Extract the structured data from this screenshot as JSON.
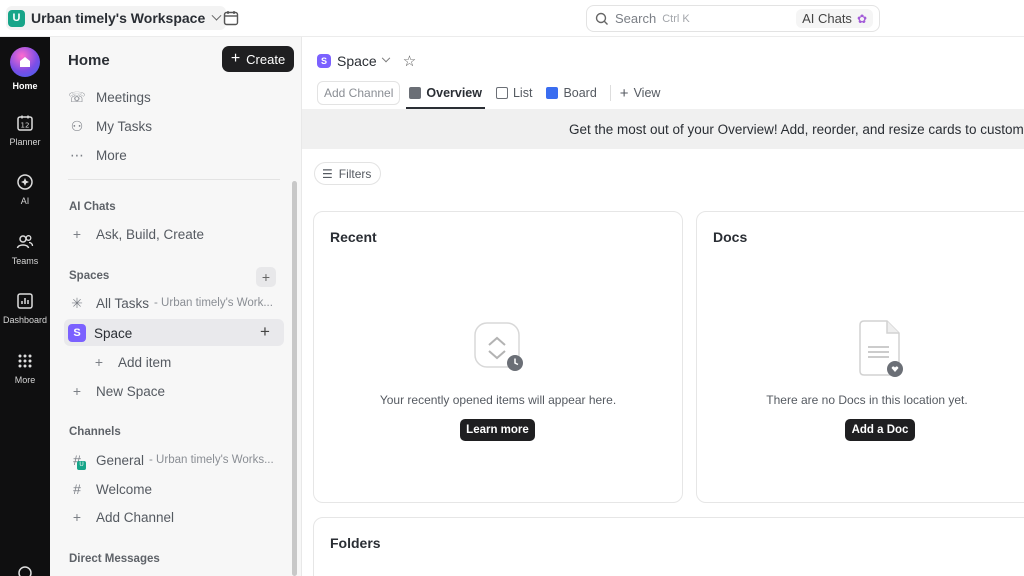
{
  "topbar": {
    "workspace_initial": "U",
    "workspace_name": "Urban timely's Workspace",
    "search_placeholder": "Search",
    "search_shortcut": "Ctrl K",
    "ai_chats_label": "AI Chats"
  },
  "rail": {
    "items": [
      {
        "label": "Home",
        "icon": "home-icon"
      },
      {
        "label": "Planner",
        "icon": "calendar-icon"
      },
      {
        "label": "AI",
        "icon": "ai-icon"
      },
      {
        "label": "Teams",
        "icon": "teams-icon"
      },
      {
        "label": "Dashboard",
        "icon": "dashboard-icon"
      },
      {
        "label": "More",
        "icon": "grid-icon"
      }
    ],
    "planner_day": "12"
  },
  "sidebar": {
    "title": "Home",
    "create_label": "Create",
    "nav": [
      {
        "label": "Meetings",
        "icon": "phone-icon"
      },
      {
        "label": "My Tasks",
        "icon": "user-icon"
      },
      {
        "label": "More",
        "icon": "more-icon"
      }
    ],
    "ai_chats_heading": "AI Chats",
    "ai_chats_action": "Ask, Build, Create",
    "spaces_heading": "Spaces",
    "all_tasks_label": "All Tasks",
    "all_tasks_sub": "- Urban timely's Work...",
    "space_initial": "S",
    "space_label": "Space",
    "add_item_label": "Add item",
    "new_space_label": "New Space",
    "channels_heading": "Channels",
    "channel_general_label": "General",
    "channel_general_sub": "- Urban timely's Works...",
    "channel_welcome_label": "Welcome",
    "add_channel_label": "Add Channel",
    "dm_heading": "Direct Messages"
  },
  "main": {
    "space_initial": "S",
    "breadcrumb_space": "Space",
    "tabs": {
      "add_channel": "Add Channel",
      "overview": "Overview",
      "list": "List",
      "board": "Board",
      "view": "View"
    },
    "banner_text": "Get the most out of your Overview! Add, reorder, and resize cards to customize",
    "filters_label": "Filters",
    "recent": {
      "title": "Recent",
      "empty_text": "Your recently opened items will appear here.",
      "button": "Learn more"
    },
    "docs": {
      "title": "Docs",
      "empty_text": "There are no Docs in this location yet.",
      "button": "Add a Doc"
    },
    "folders": {
      "title": "Folders"
    }
  },
  "colors": {
    "accent_space": "#7b61ff",
    "workspace_logo": "#17a589",
    "dark_button": "#1f1f21",
    "rail_bg": "#0f0f10"
  }
}
